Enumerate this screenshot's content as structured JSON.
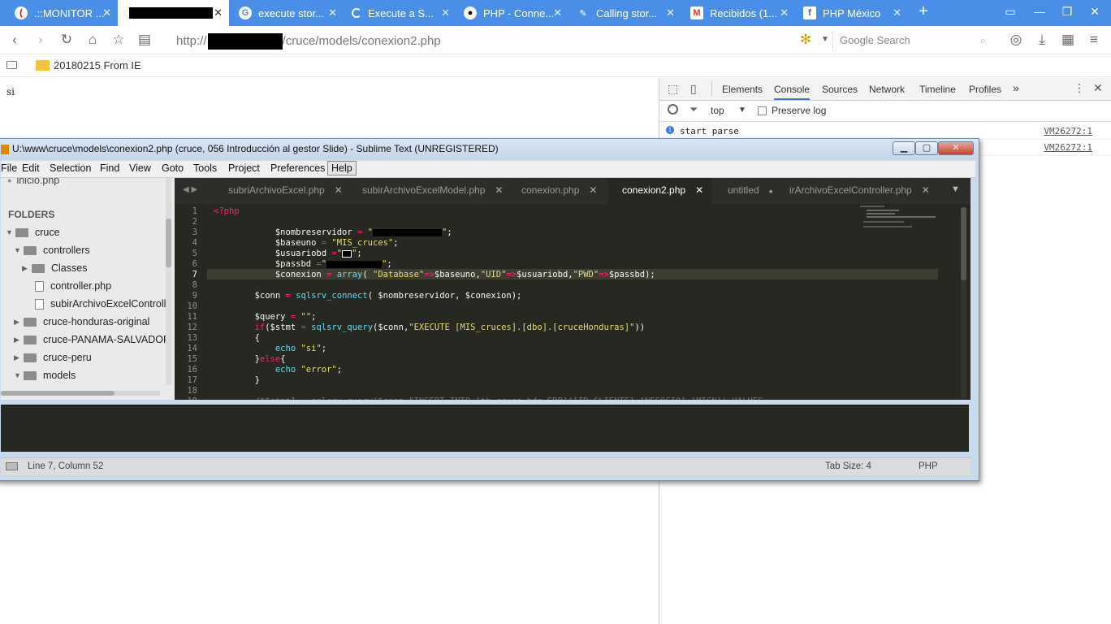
{
  "browser": {
    "tabs": [
      {
        "title": ".::MONITOR ...",
        "icon": "monitor-icon",
        "close": "✕"
      },
      {
        "title": "",
        "icon": "",
        "close": "✕",
        "active": true
      },
      {
        "title": "execute stor...",
        "icon": "google-icon",
        "close": "✕"
      },
      {
        "title": "Execute a S...",
        "icon": "loading-icon",
        "close": "✕"
      },
      {
        "title": "PHP - Conne...",
        "icon": "github-icon",
        "close": "✕"
      },
      {
        "title": "Calling stor...",
        "icon": "php-icon",
        "close": "✕"
      },
      {
        "title": "Recibidos (1...",
        "icon": "gmail-icon",
        "close": "✕"
      },
      {
        "title": "PHP México",
        "icon": "facebook-icon",
        "close": "✕"
      }
    ],
    "new_tab": "+",
    "url_prefix": "http://",
    "url_suffix": "/cruce/models/conexion2.php",
    "search_placeholder": "Google Search",
    "bookmark": "20180215 From IE"
  },
  "page": {
    "body_text": "si"
  },
  "devtools": {
    "tabs": [
      "Elements",
      "Console",
      "Sources",
      "Network",
      "Timeline",
      "Profiles"
    ],
    "more": "»",
    "context": "top",
    "preserve_log": "Preserve log",
    "logs": [
      {
        "text": "start parse",
        "source": "VM26272:1"
      },
      {
        "text": "",
        "source": "VM26272:1"
      }
    ]
  },
  "sublime": {
    "title": "U:\\www\\cruce\\models\\conexion2.php (cruce, 056 Introducción al gestor Slide) - Sublime Text (UNREGISTERED)",
    "menu": [
      "File",
      "Edit",
      "Selection",
      "Find",
      "View",
      "Goto",
      "Tools",
      "Project",
      "Preferences",
      "Help"
    ],
    "sidebar_top_file": "inicio.php",
    "folders_header": "FOLDERS",
    "tree": [
      {
        "label": "cruce",
        "type": "folder-open"
      },
      {
        "label": "controllers",
        "type": "folder-open"
      },
      {
        "label": "Classes",
        "type": "folder"
      },
      {
        "label": "controller.php",
        "type": "file"
      },
      {
        "label": "subirArchivoExcelControlle",
        "type": "file"
      },
      {
        "label": "cruce-honduras-original",
        "type": "folder"
      },
      {
        "label": "cruce-PANAMA-SALVADOR",
        "type": "folder"
      },
      {
        "label": "cruce-peru",
        "type": "folder"
      },
      {
        "label": "models",
        "type": "folder-open"
      }
    ],
    "tabs": [
      {
        "label": "subriArchivoExcel.php",
        "close": "✕"
      },
      {
        "label": "subirArchivoExcelModel.php",
        "close": "✕"
      },
      {
        "label": "conexion.php",
        "close": "✕"
      },
      {
        "label": "conexion2.php",
        "close": "✕",
        "active": true
      },
      {
        "label": "untitled",
        "close": "●"
      },
      {
        "label": "irArchivoExcelController.php",
        "close": "✕"
      }
    ],
    "line_numbers": [
      "1",
      "2",
      "3",
      "4",
      "5",
      "6",
      "7",
      "8",
      "9",
      "10",
      "11",
      "12",
      "13",
      "14",
      "15",
      "16",
      "17",
      "18",
      "19"
    ],
    "status_left": "Line 7, Column 52",
    "status_tab_size": "Tab Size: 4",
    "status_syntax": "PHP"
  }
}
